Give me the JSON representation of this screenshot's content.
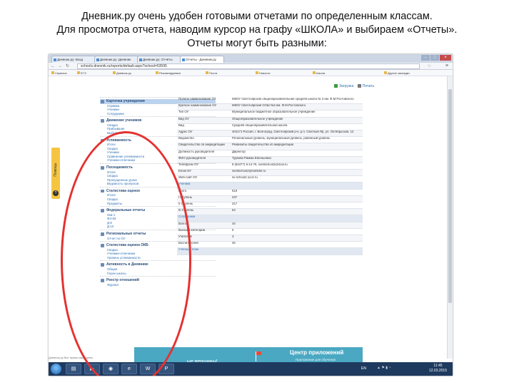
{
  "caption": {
    "line1": "Дневник.ру очень удобен готовыми отчетами по определенным классам.",
    "line2": "Для просмотра отчета, наводим курсор на графу «ШКОЛА» и выбираем «Отчеты».",
    "line3": "Отчеты могут быть разными:"
  },
  "browser": {
    "tabs": [
      "Дневник.ру: Вход",
      "Дневник.ру: Дневник",
      "Дневник.ру: Отчёты",
      "Отчеты - Дневник.ру"
    ],
    "url": "schools.dnevnik.ru/reports/default.aspx?school=53595",
    "bookmarks": [
      "Сервисы",
      "ЕГЭ",
      "Дневник.ру",
      "Рекомендуемые",
      "Почта",
      "Новости",
      "Школа",
      "Другие закладки"
    ]
  },
  "help_tab": "Помощь",
  "top_actions": {
    "print": "Загрузка",
    "export": "Печать"
  },
  "sidebar": [
    {
      "title": "Карточка учреждения",
      "highlight": true,
      "items": [
        "Справка",
        "Ученики",
        "Сотрудники"
      ]
    },
    {
      "title": "Движение учеников",
      "items": [
        "Сводка",
        "Прибывшие",
        "Выбывшие"
      ]
    },
    {
      "title": "Успеваемость",
      "items": [
        "Итоги",
        "Сводка",
        "Ученики",
        "Сравнение успеваемости",
        "Ученики-отличники"
      ]
    },
    {
      "title": "Посещаемость",
      "items": [
        "Итоги",
        "Сводка",
        "Пропущенные уроки",
        "Ведомость пропусков"
      ]
    },
    {
      "title": "Статистика оценок",
      "items": [
        "Итоги",
        "Сводка",
        "Предметы"
      ]
    },
    {
      "title": "Федеральные отчеты",
      "items": [
        "ОШ-1",
        "ФЗ-83",
        "Д-8",
        "Д-10"
      ]
    },
    {
      "title": "Региональные отчеты",
      "items": [
        "Отчет по ОУ"
      ]
    },
    {
      "title": "Статистика оценок ОКБ",
      "items": [
        "Сводка",
        "Ученики-отличники",
        "Уровень успеваемости"
      ]
    },
    {
      "title": "Активность в Дневнике",
      "items": [
        "Общая",
        "Герои школы"
      ]
    },
    {
      "title": "Реестр отношений",
      "items": [
        "Журнал"
      ]
    }
  ],
  "table_rows": [
    {
      "label": "Полное наименование ОУ",
      "value": "МКОУ Светлоярская общеобразовательная средняя школа № 2 им. Ф.М.Ростовского"
    },
    {
      "label": "Краткое наименование ОУ",
      "value": "МКОУ Светлоярская СОШ №2 им. Ф.М.Ростовского"
    },
    {
      "label": "Тип ОУ",
      "value": "Муниципальное бюджетное образовательное учреждение"
    },
    {
      "label": "Вид ОУ",
      "value": "Общеобразовательное учреждение"
    },
    {
      "label": "Вид",
      "value": "Средняя общеобразовательная школа"
    },
    {
      "label": "Адрес ОУ",
      "value": "404171 Россия, г. Волгоград, Светлоярский р-н, р.п. Светлый Яр, ул. Октябрьская, 12"
    },
    {
      "label": "Ведомство",
      "value": "Региональный уровень, муниципальный уровень, районный уровень"
    },
    {
      "label": "Свидетельство об аккредитации",
      "value": "Реквизиты свидетельства об аккредитации"
    },
    {
      "label": "Должность руководителя",
      "value": "Директор"
    },
    {
      "label": "ФИО руководителя",
      "value": "Туркова Римма Евгеньевна"
    },
    {
      "label": "Телефоны ОУ",
      "value": "8 (84477) 6-14-76, svetlschool2@mail.ru"
    },
    {
      "label": "Email ОУ",
      "value": "svetlschool2@rambler.ru"
    },
    {
      "label": "Web-сайт ОУ",
      "value": "sv-school2.ucoz.ru"
    },
    {
      "section": true,
      "label": "Ученики",
      "value": ""
    },
    {
      "label": "Всего",
      "value": "519"
    },
    {
      "label": "I Ступень",
      "value": "237"
    },
    {
      "label": "II Ступень",
      "value": "217"
    },
    {
      "label": "III Ступень",
      "value": "64"
    },
    {
      "section": true,
      "label": "Сотрудники",
      "value": ""
    },
    {
      "label": "Всего",
      "value": "44"
    },
    {
      "label": "Высшей категории",
      "value": "5"
    },
    {
      "label": "Учителей",
      "value": "3"
    },
    {
      "label": "Воспитателей",
      "value": "26"
    },
    {
      "section": true,
      "label": "Учебный план",
      "value": ""
    }
  ],
  "footer_text": "Дневник.ру Все права защищены",
  "banner": {
    "left": "...ые вершины!",
    "title": "Центр приложений",
    "subtitle": "Приложения для обучения"
  },
  "taskbar": {
    "lang": "EN",
    "time": "11:45",
    "date": "12.03.2015"
  }
}
